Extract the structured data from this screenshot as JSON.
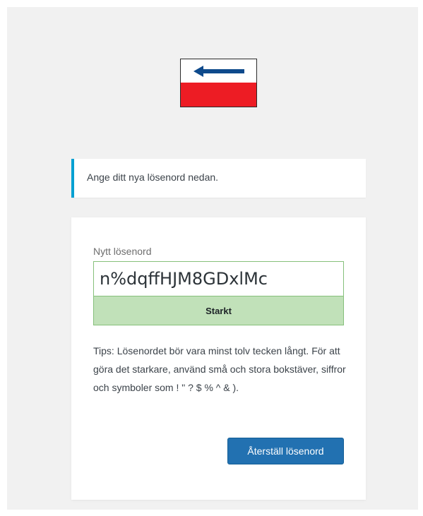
{
  "logo": {
    "icon": "back-arrow-icon",
    "colors": {
      "arrow": "#0e4a8c",
      "bar": "#ed1c24"
    }
  },
  "notice": {
    "text": "Ange ditt nya lösenord nedan.",
    "accent_color": "#00a0d2"
  },
  "form": {
    "label": "Nytt lösenord",
    "password_value": "n%dqffHJM8GDxlMc",
    "strength_label": "Starkt",
    "hint": "Tips: Lösenordet bör vara minst tolv tecken långt. För att göra det starkare, använd små och stora bokstäver, siffror och symboler som ! \" ? $ % ^ & ).",
    "submit_label": "Återställ lösenord"
  }
}
